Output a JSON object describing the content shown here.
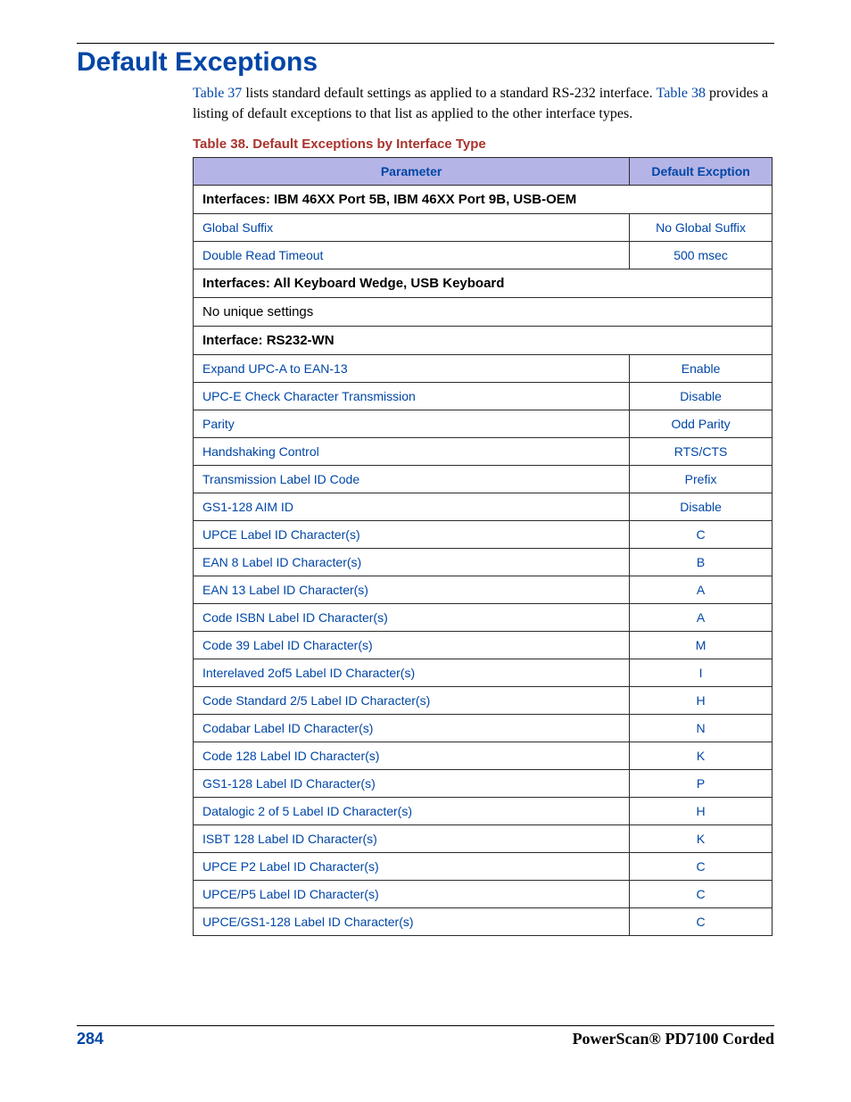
{
  "title": "Default Exceptions",
  "intro": {
    "link1": "Table 37",
    "text1": " lists standard default settings as applied to a standard RS-232 interface. ",
    "link2": "Table 38",
    "text2": " provides a listing of default exceptions to that list as applied to the other interface types."
  },
  "table_caption": "Table 38. Default Exceptions by Interface Type",
  "table": {
    "header_param": "Parameter",
    "header_value": "Default Excption",
    "rows": [
      {
        "type": "section",
        "label": "Interfaces: IBM 46XX Port 5B, IBM 46XX Port 9B, USB-OEM"
      },
      {
        "type": "param",
        "param": "Global Suffix",
        "value": "No Global Suffix"
      },
      {
        "type": "param",
        "param": "Double Read Timeout",
        "value": "500 msec"
      },
      {
        "type": "section",
        "label": "Interfaces: All Keyboard Wedge, USB Keyboard"
      },
      {
        "type": "plain",
        "label": "No unique settings"
      },
      {
        "type": "section",
        "label": "Interface: RS232-WN"
      },
      {
        "type": "param",
        "param": "Expand UPC-A to EAN-13",
        "value": "Enable"
      },
      {
        "type": "param",
        "param": "UPC-E Check Character Transmission",
        "value": "Disable"
      },
      {
        "type": "param",
        "param": "Parity",
        "value": "Odd Parity"
      },
      {
        "type": "param",
        "param": "Handshaking Control",
        "value": "RTS/CTS"
      },
      {
        "type": "param",
        "param": "Transmission Label ID Code",
        "value": "Prefix"
      },
      {
        "type": "param",
        "param": "GS1-128 AIM ID",
        "value": "Disable"
      },
      {
        "type": "param",
        "param": "UPCE Label ID Character(s)",
        "value": "C"
      },
      {
        "type": "param",
        "param": "EAN 8 Label ID Character(s)",
        "value": "B"
      },
      {
        "type": "param",
        "param": "EAN 13 Label ID Character(s)",
        "value": "A"
      },
      {
        "type": "param",
        "param": "Code ISBN Label ID Character(s)",
        "value": "A"
      },
      {
        "type": "param",
        "param": "Code 39 Label ID Character(s)",
        "value": "M"
      },
      {
        "type": "param",
        "param": "Interelaved 2of5 Label ID Character(s)",
        "value": "I"
      },
      {
        "type": "param",
        "param": "Code Standard 2/5 Label ID Character(s)",
        "value": "H"
      },
      {
        "type": "param",
        "param": "Codabar Label ID Character(s)",
        "value": "N"
      },
      {
        "type": "param",
        "param": "Code 128 Label ID Character(s)",
        "value": "K"
      },
      {
        "type": "param",
        "param": "GS1-128 Label ID Character(s)",
        "value": "P"
      },
      {
        "type": "param",
        "param": "Datalogic 2 of 5 Label ID Character(s)",
        "value": "H"
      },
      {
        "type": "param",
        "param": "ISBT 128 Label ID Character(s)",
        "value": "K"
      },
      {
        "type": "param",
        "param": "UPCE P2 Label ID Character(s)",
        "value": "C"
      },
      {
        "type": "param",
        "param": "UPCE/P5 Label ID Character(s)",
        "value": "C"
      },
      {
        "type": "param",
        "param": "UPCE/GS1-128 Label ID Character(s)",
        "value": "C"
      }
    ]
  },
  "footer": {
    "page_number": "284",
    "product_name": "PowerScan® PD7100 Corded"
  }
}
